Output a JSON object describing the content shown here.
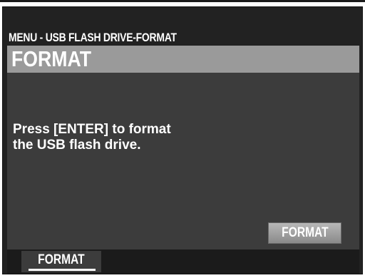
{
  "header": {
    "breadcrumb": "MENU - USB FLASH DRIVE-FORMAT",
    "title": "FORMAT"
  },
  "main": {
    "message_line1": "Press [ENTER] to format",
    "message_line2": "the USB flash drive.",
    "action_button_label": "FORMAT"
  },
  "bottom_tabs": {
    "items": [
      {
        "label": "FORMAT",
        "selected": true
      }
    ]
  },
  "colors": {
    "screen_background": "#222222",
    "content_background": "#3c3c3c",
    "title_bar": "#9a9a9a",
    "text": "#ffffff",
    "button": "#a0a0a0",
    "bottom_bar": "#1b1b1b"
  }
}
